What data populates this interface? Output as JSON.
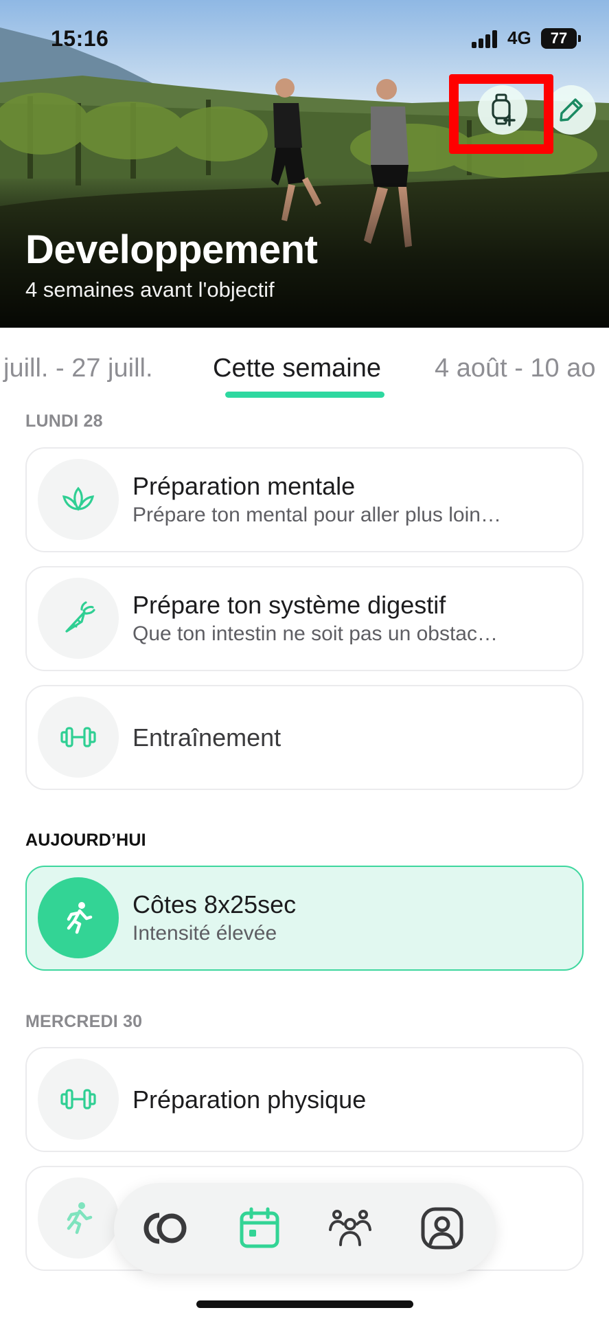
{
  "status_bar": {
    "time": "15:16",
    "network": "4G",
    "battery": "77"
  },
  "hero": {
    "title": "Developpement",
    "subtitle": "4 semaines avant l'objectif",
    "watch_icon": "watch-plus-icon",
    "edit_icon": "pencil-icon"
  },
  "week_tabs": {
    "prev": "juill. - 27 juill.",
    "current": "Cette semaine",
    "next": "4 août - 10 ao"
  },
  "days": [
    {
      "label": "LUNDI 28",
      "items": [
        {
          "title": "Préparation mentale",
          "subtitle": "Prépare ton mental pour aller plus loin…",
          "icon": "lotus-icon"
        },
        {
          "title": "Prépare ton système digestif",
          "subtitle": "Que ton intestin ne soit pas un obstac…",
          "icon": "carrot-icon"
        },
        {
          "title": "Entraînement",
          "subtitle": "",
          "icon": "dumbbell-icon"
        }
      ]
    },
    {
      "label": "AUJOURD’HUI",
      "items": [
        {
          "title": "Côtes 8x25sec",
          "subtitle": "Intensité élevée",
          "icon": "runner-icon"
        }
      ]
    },
    {
      "label": "MERCREDI 30",
      "items": [
        {
          "title": "Préparation physique",
          "subtitle": "",
          "icon": "dumbbell-icon"
        },
        {
          "title": "",
          "subtitle": "",
          "icon": "runner-icon"
        }
      ]
    }
  ],
  "bottom_nav": {
    "items": [
      {
        "icon": "brand-logo-icon"
      },
      {
        "icon": "calendar-icon",
        "active": true
      },
      {
        "icon": "community-icon"
      },
      {
        "icon": "profile-icon"
      }
    ]
  },
  "colors": {
    "accent": "#33D495",
    "active_card_bg": "#E1F8F0",
    "highlight": "#FF0000"
  }
}
